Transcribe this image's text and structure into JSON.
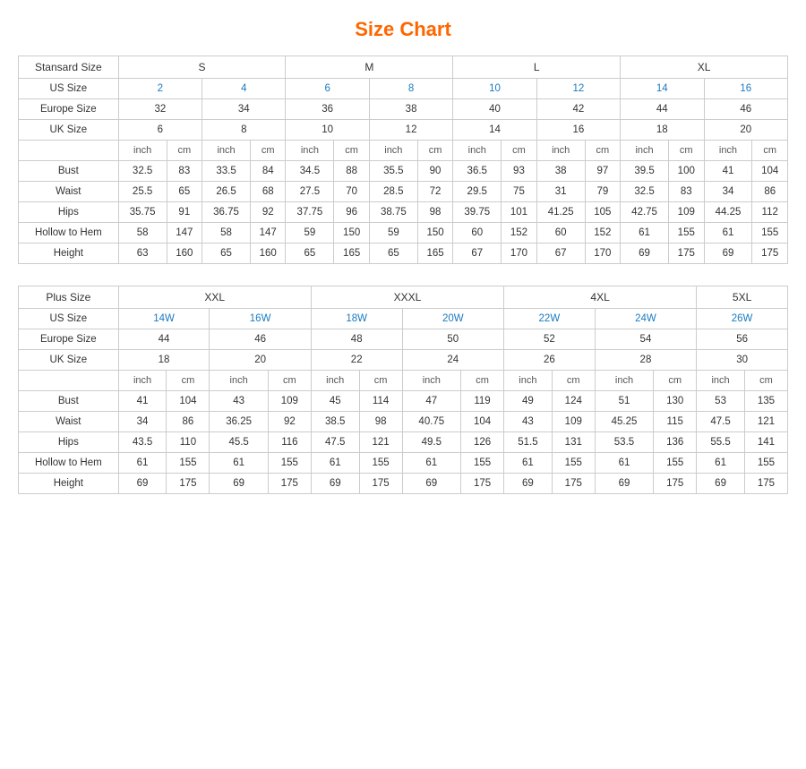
{
  "title": "Size Chart",
  "standard": {
    "section_label": "Stansard Size",
    "size_groups": [
      "S",
      "M",
      "L",
      "XL"
    ],
    "us_size_label": "US Size",
    "eu_size_label": "Europe Size",
    "uk_size_label": "UK Size",
    "us_sizes": [
      "2",
      "4",
      "6",
      "8",
      "10",
      "12",
      "14",
      "16"
    ],
    "eu_sizes": [
      "32",
      "34",
      "36",
      "38",
      "40",
      "42",
      "44",
      "46"
    ],
    "uk_sizes": [
      "6",
      "8",
      "10",
      "12",
      "14",
      "16",
      "18",
      "20"
    ],
    "measurements": [
      {
        "label": "Bust",
        "values": [
          "32.5",
          "83",
          "33.5",
          "84",
          "34.5",
          "88",
          "35.5",
          "90",
          "36.5",
          "93",
          "38",
          "97",
          "39.5",
          "100",
          "41",
          "104"
        ]
      },
      {
        "label": "Waist",
        "values": [
          "25.5",
          "65",
          "26.5",
          "68",
          "27.5",
          "70",
          "28.5",
          "72",
          "29.5",
          "75",
          "31",
          "79",
          "32.5",
          "83",
          "34",
          "86"
        ]
      },
      {
        "label": "Hips",
        "values": [
          "35.75",
          "91",
          "36.75",
          "92",
          "37.75",
          "96",
          "38.75",
          "98",
          "39.75",
          "101",
          "41.25",
          "105",
          "42.75",
          "109",
          "44.25",
          "112"
        ]
      },
      {
        "label": "Hollow to Hem",
        "values": [
          "58",
          "147",
          "58",
          "147",
          "59",
          "150",
          "59",
          "150",
          "60",
          "152",
          "60",
          "152",
          "61",
          "155",
          "61",
          "155"
        ]
      },
      {
        "label": "Height",
        "values": [
          "63",
          "160",
          "65",
          "160",
          "65",
          "165",
          "65",
          "165",
          "67",
          "170",
          "67",
          "170",
          "69",
          "175",
          "69",
          "175"
        ]
      }
    ]
  },
  "plus": {
    "section_label": "Plus Size",
    "size_groups": [
      "XXL",
      "XXXL",
      "4XL",
      "5XL"
    ],
    "us_size_label": "US Size",
    "eu_size_label": "Europe Size",
    "uk_size_label": "UK Size",
    "us_sizes": [
      "14W",
      "16W",
      "18W",
      "20W",
      "22W",
      "24W",
      "26W"
    ],
    "eu_sizes": [
      "44",
      "46",
      "48",
      "50",
      "52",
      "54",
      "56"
    ],
    "uk_sizes": [
      "18",
      "20",
      "22",
      "24",
      "26",
      "28",
      "30"
    ],
    "measurements": [
      {
        "label": "Bust",
        "values": [
          "41",
          "104",
          "43",
          "109",
          "45",
          "114",
          "47",
          "119",
          "49",
          "124",
          "51",
          "130",
          "53",
          "135"
        ]
      },
      {
        "label": "Waist",
        "values": [
          "34",
          "86",
          "36.25",
          "92",
          "38.5",
          "98",
          "40.75",
          "104",
          "43",
          "109",
          "45.25",
          "115",
          "47.5",
          "121"
        ]
      },
      {
        "label": "Hips",
        "values": [
          "43.5",
          "110",
          "45.5",
          "116",
          "47.5",
          "121",
          "49.5",
          "126",
          "51.5",
          "131",
          "53.5",
          "136",
          "55.5",
          "141"
        ]
      },
      {
        "label": "Hollow to Hem",
        "values": [
          "61",
          "155",
          "61",
          "155",
          "61",
          "155",
          "61",
          "155",
          "61",
          "155",
          "61",
          "155",
          "61",
          "155"
        ]
      },
      {
        "label": "Height",
        "values": [
          "69",
          "175",
          "69",
          "175",
          "69",
          "175",
          "69",
          "175",
          "69",
          "175",
          "69",
          "175",
          "69",
          "175"
        ]
      }
    ]
  }
}
